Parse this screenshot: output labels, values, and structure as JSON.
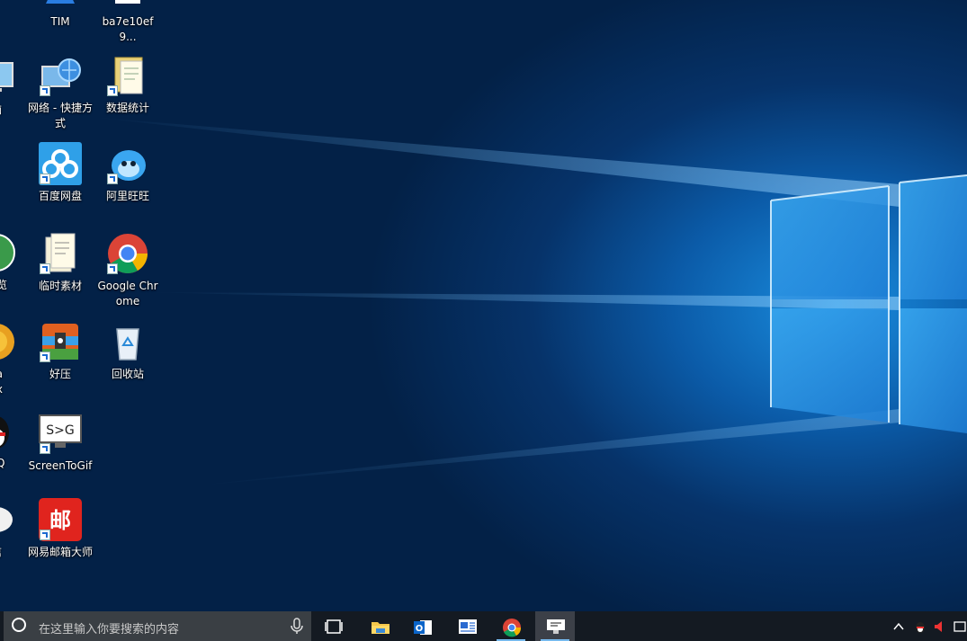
{
  "desktop": {
    "icons": [
      {
        "label": "TIM"
      },
      {
        "label": "ba7e10ef9..."
      },
      {
        "label": "脑"
      },
      {
        "label": "网络 - 快捷方式"
      },
      {
        "label": "数据统计"
      },
      {
        "label": "百度网盘"
      },
      {
        "label": "阿里旺旺"
      },
      {
        "label": "浏览"
      },
      {
        "label": "临时素材"
      },
      {
        "label": "Google Chrome"
      },
      {
        "label": "lla\nox"
      },
      {
        "label": "好压"
      },
      {
        "label": "回收站"
      },
      {
        "label": "QQ"
      },
      {
        "label": "ScreenToGif"
      },
      {
        "label": "信"
      },
      {
        "label": "网易邮箱大师"
      }
    ]
  },
  "taskbar": {
    "search_placeholder": "在这里输入你要搜索的内容",
    "apps": [
      "task-view",
      "file-explorer",
      "outlook",
      "news",
      "google-chrome",
      "screentogif"
    ],
    "tray_icons": [
      "chevron-up-icon",
      "qq-tray-icon",
      "volume-icon",
      "ime-icon"
    ]
  },
  "colors": {
    "taskbar": "#141a22",
    "search_box": "#3a3f44",
    "wallpaper_light": "#1a8ee0",
    "wallpaper_dark": "#032147"
  }
}
